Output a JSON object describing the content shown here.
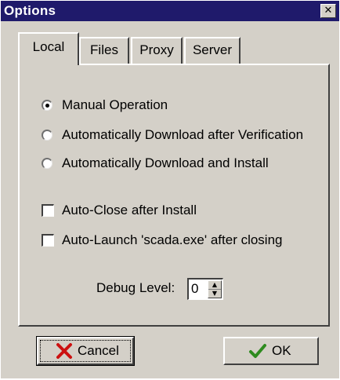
{
  "window": {
    "title": "Options",
    "close_glyph": "✕"
  },
  "tabs": [
    {
      "label": "Local",
      "active": true
    },
    {
      "label": "Files",
      "active": false
    },
    {
      "label": "Proxy",
      "active": false
    },
    {
      "label": "Server",
      "active": false
    }
  ],
  "radios": [
    {
      "label": "Manual Operation",
      "checked": true
    },
    {
      "label": "Automatically Download after Verification",
      "checked": false
    },
    {
      "label": "Automatically Download and Install",
      "checked": false
    }
  ],
  "checkboxes": [
    {
      "label": "Auto-Close after Install",
      "checked": false
    },
    {
      "label": "Auto-Launch 'scada.exe' after closing",
      "checked": false
    }
  ],
  "debug": {
    "label": "Debug Level:",
    "value": "0"
  },
  "buttons": {
    "cancel": {
      "label": "Cancel",
      "icon": "red-x-icon",
      "color": "#cc1111"
    },
    "ok": {
      "label": "OK",
      "icon": "green-check-icon",
      "color": "#2e8b1f"
    }
  },
  "colors": {
    "titlebar": "#1f1a6b",
    "face": "#d4d0c8"
  }
}
